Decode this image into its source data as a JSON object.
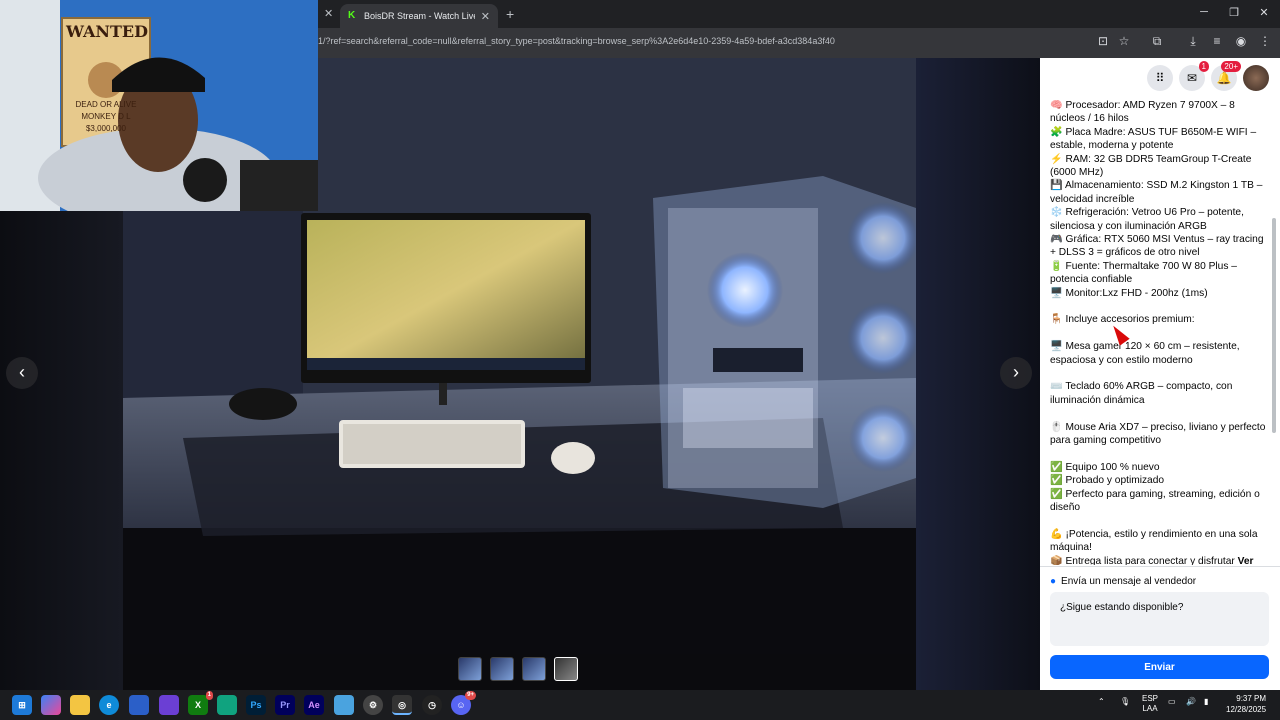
{
  "browser": {
    "tab_title": "BoisDR Stream - Watch Live on",
    "url": "1/?ref=search&referral_code=null&referral_story_type=post&tracking=browse_serp%3A2e6d4e10-2359-4a59-bdef-a3cd384a3f40"
  },
  "header": {
    "messenger_badge": "1",
    "notifications_badge": "20+"
  },
  "listing": {
    "description": [
      "🧠 Procesador: AMD Ryzen 7 9700X – 8 núcleos / 16 hilos",
      "🧩 Placa Madre: ASUS TUF B650M-E WIFI – estable, moderna y potente",
      "⚡ RAM: 32 GB DDR5 TeamGroup T-Create (6000 MHz)",
      "💾 Almacenamiento: SSD M.2 Kingston 1 TB – velocidad increíble",
      "❄️ Refrigeración: Vetroo U6 Pro – potente, silenciosa y con iluminación ARGB",
      "🎮 Gráfica: RTX 5060 MSI Ventus – ray tracing + DLSS 3 = gráficos de otro nivel",
      "🔋 Fuente: Thermaltake 700 W 80 Plus – potencia confiable",
      "🖥️ Monitor:Lxz FHD - 200hz (1ms)",
      "",
      "🪑 Incluye accesorios premium:",
      "",
      "🖥️ Mesa gamer 120 × 60 cm – resistente, espaciosa y con estilo moderno",
      "",
      "⌨️ Teclado 60% ARGB – compacto, con iluminación dinámica",
      "",
      "🖱️ Mouse Aria XD7 – preciso, liviano y perfecto para gaming competitivo",
      "",
      "✅ Equipo 100 % nuevo",
      "✅ Probado y optimizado",
      "✅ Perfecto para gaming, streaming, edición o diseño",
      "",
      "💪 ¡Potencia, estilo y rendimiento en una sola máquina!",
      "📦 Entrega lista para conectar y disfrutar"
    ],
    "see_more": "Ver",
    "message_label": "Envía un mensaje al vendedor",
    "message_value": "¿Sigue estando disponible?",
    "send_button": "Enviar"
  },
  "photo": {
    "poster_text": "WANTED",
    "poster_subtext": "DEAD OR ALIVE",
    "poster_name": "MONKEY D L",
    "poster_bounty": "$3,000,000"
  },
  "taskbar": {
    "badges": [
      "1",
      "9+"
    ],
    "lang_top": "ESP",
    "lang_bottom": "LAA",
    "time": "9:37 PM",
    "date": "12/28/2025"
  }
}
